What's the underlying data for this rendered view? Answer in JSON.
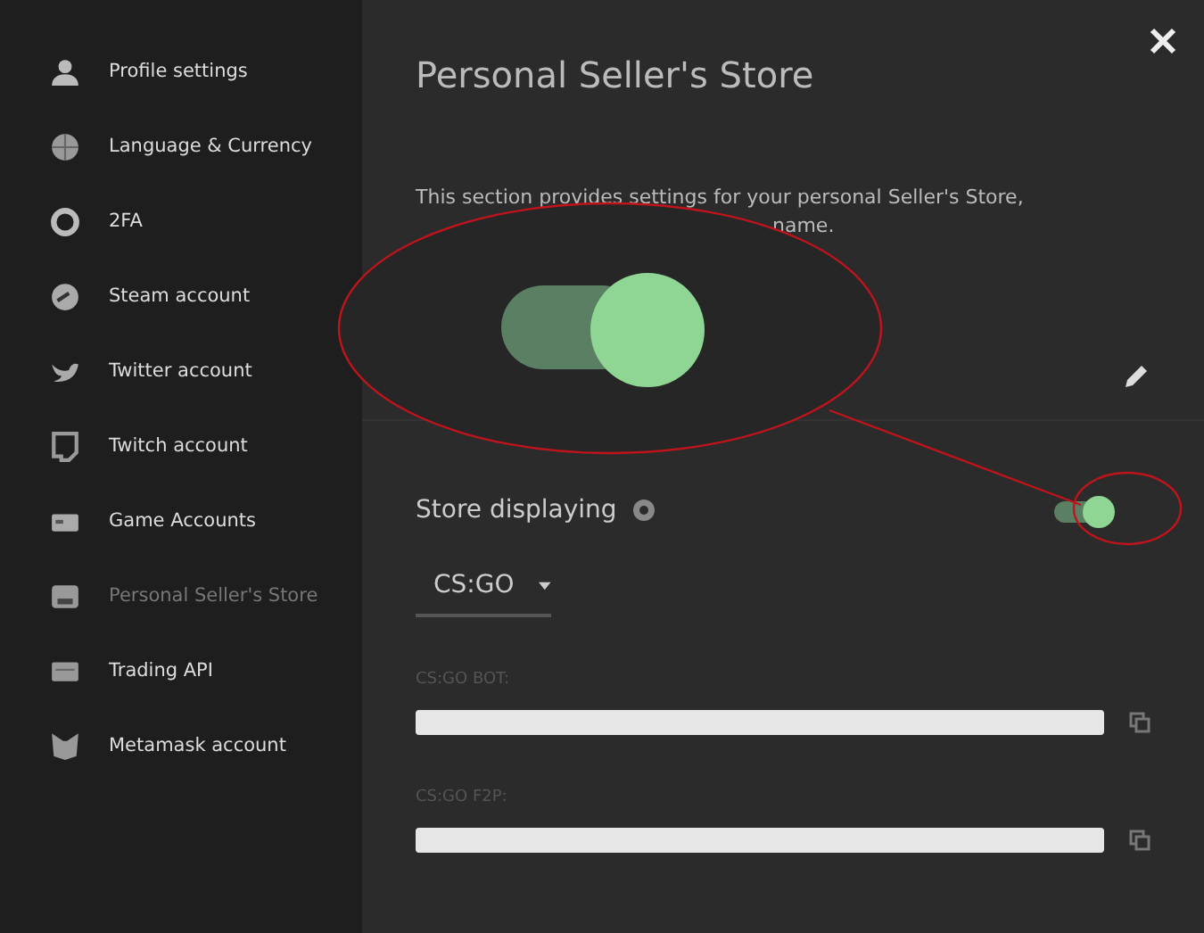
{
  "sidebar": {
    "items": [
      {
        "label": "Profile settings",
        "selected": false
      },
      {
        "label": "Language & Currency",
        "selected": false
      },
      {
        "label": "2FA",
        "selected": false
      },
      {
        "label": "Steam account",
        "selected": false
      },
      {
        "label": "Twitter account",
        "selected": false
      },
      {
        "label": "Twitch account",
        "selected": false
      },
      {
        "label": "Game Accounts",
        "selected": false
      },
      {
        "label": "Personal Seller's Store",
        "selected": true
      },
      {
        "label": "Trading API",
        "selected": false
      },
      {
        "label": "Metamask account",
        "selected": false
      }
    ]
  },
  "panel": {
    "title": "Personal Seller's Store",
    "description": "This section provides settings for your personal Seller's Store,",
    "description_tail": "name.",
    "store_displaying": {
      "label": "Store displaying",
      "on": true
    },
    "game_select": {
      "value": "CS:GO"
    },
    "fields": [
      {
        "label": "CS:GO BOT:"
      },
      {
        "label": "CS:GO F2P:"
      }
    ]
  },
  "callout": {
    "on": true
  }
}
